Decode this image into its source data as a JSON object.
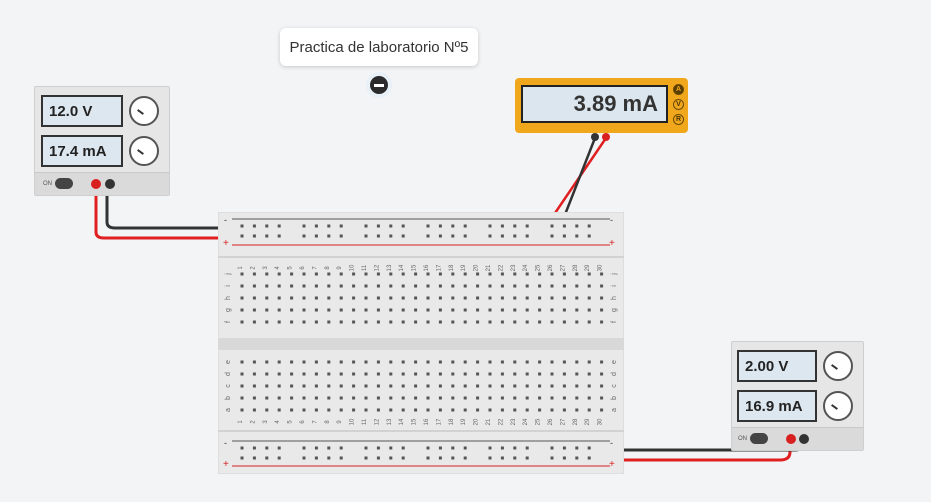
{
  "annotation": {
    "text": "Practica de laboratorio Nº5"
  },
  "psu_left": {
    "voltage": "12.0 V",
    "current": "17.4 mA",
    "switch_label": "ON"
  },
  "psu_right": {
    "voltage": "2.00 V",
    "current": "16.9 mA",
    "switch_label": "ON"
  },
  "multimeter": {
    "reading": "3.89 mA",
    "modes": [
      "A",
      "V",
      "R"
    ],
    "active_mode": "A"
  },
  "breadboard": {
    "rail_minus": "-",
    "rail_plus": "+",
    "column_numbers": [
      "1",
      "2",
      "3",
      "4",
      "5",
      "6",
      "7",
      "8",
      "9",
      "10",
      "11",
      "12",
      "13",
      "14",
      "15",
      "16",
      "17",
      "18",
      "19",
      "20",
      "21",
      "22",
      "23",
      "24",
      "25",
      "26",
      "27",
      "28",
      "29",
      "30"
    ],
    "row_letters_top": [
      "j",
      "i",
      "h",
      "g",
      "f"
    ],
    "row_letters_bottom": [
      "e",
      "d",
      "c",
      "b",
      "a"
    ]
  },
  "colors": {
    "wire_red": "#e02020",
    "wire_black": "#333333",
    "jumper_green": "#3cb44b",
    "meter_body": "#f0a71b"
  }
}
